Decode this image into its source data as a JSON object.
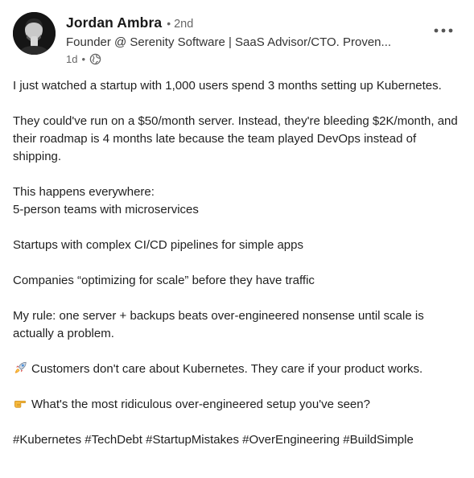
{
  "author": {
    "name": "Jordan Ambra",
    "degree": "2nd",
    "headline": "Founder @ Serenity Software | SaaS Advisor/CTO. Proven...",
    "time": "1d"
  },
  "menu": {
    "icon": "more-horizontal-icon"
  },
  "visibility_icon": "globe-icon",
  "post": {
    "p1": "I just watched a startup with 1,000 users spend 3 months setting up Kubernetes.",
    "p2": "They could've run on a $50/month server. Instead, they're bleeding $2K/month, and their roadmap is 4 months late because the team played DevOps instead of shipping.",
    "p3_heading": "This happens everywhere:",
    "p3_item": "5-person teams with microservices",
    "p4": "Startups with complex CI/CD pipelines for simple apps",
    "p5": "Companies “optimizing for scale” before they have traffic",
    "p6": "My rule: one server + backups beats over-engineered nonsense until scale is actually a problem.",
    "p7": "Customers don't care about Kubernetes. They care if your product works.",
    "p7_emoji": "rocket-icon",
    "p8": "What's the most ridiculous over-engineered setup you've seen?",
    "p8_emoji": "pointing-hand-icon",
    "hashtags": "#Kubernetes #TechDebt #StartupMistakes #OverEngineering #BuildSimple"
  }
}
